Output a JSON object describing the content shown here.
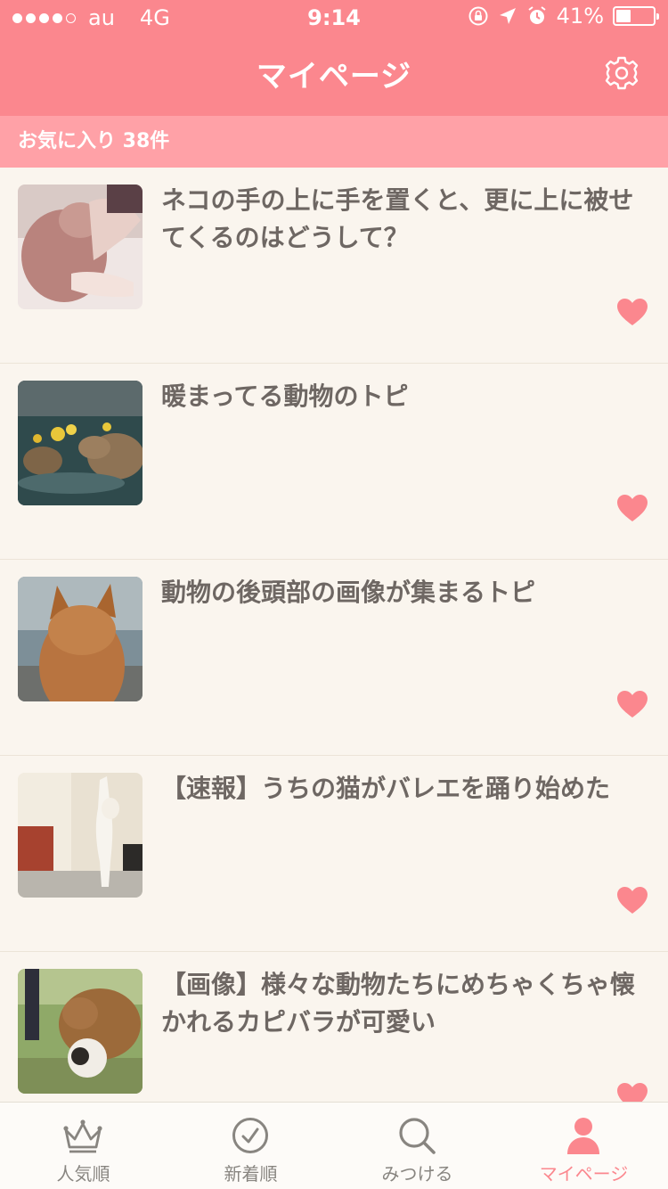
{
  "status_bar": {
    "carrier": "au",
    "network": "4G",
    "time": "9:14",
    "battery": "41%",
    "battery_level": 0.41
  },
  "header": {
    "title": "マイページ",
    "settings_icon": "gear-icon"
  },
  "subheader": {
    "label": "お気に入り 38件"
  },
  "favorites": [
    {
      "title": "ネコの手の上に手を置くと、更に上に被せてくるのはどうして？",
      "favorited": true
    },
    {
      "title": "暖まってる動物のトピ",
      "favorited": true
    },
    {
      "title": "動物の後頭部の画像が集まるトピ",
      "favorited": true
    },
    {
      "title": "【速報】うちの猫がバレエを踊り始めた",
      "favorited": true
    },
    {
      "title": "【画像】様々な動物たちにめちゃくちゃ懐かれるカピバラが可愛い",
      "favorited": true
    }
  ],
  "tabs": [
    {
      "label": "人気順",
      "icon": "crown-icon"
    },
    {
      "label": "新着順",
      "icon": "clock-icon"
    },
    {
      "label": "みつける",
      "icon": "search-icon"
    },
    {
      "label": "マイページ",
      "icon": "person-icon"
    }
  ],
  "colors": {
    "accent": "#fb878e",
    "subheader": "#ffa1a7",
    "background": "#faf5ee",
    "text": "#6e6763",
    "tab_inactive": "#888580"
  }
}
